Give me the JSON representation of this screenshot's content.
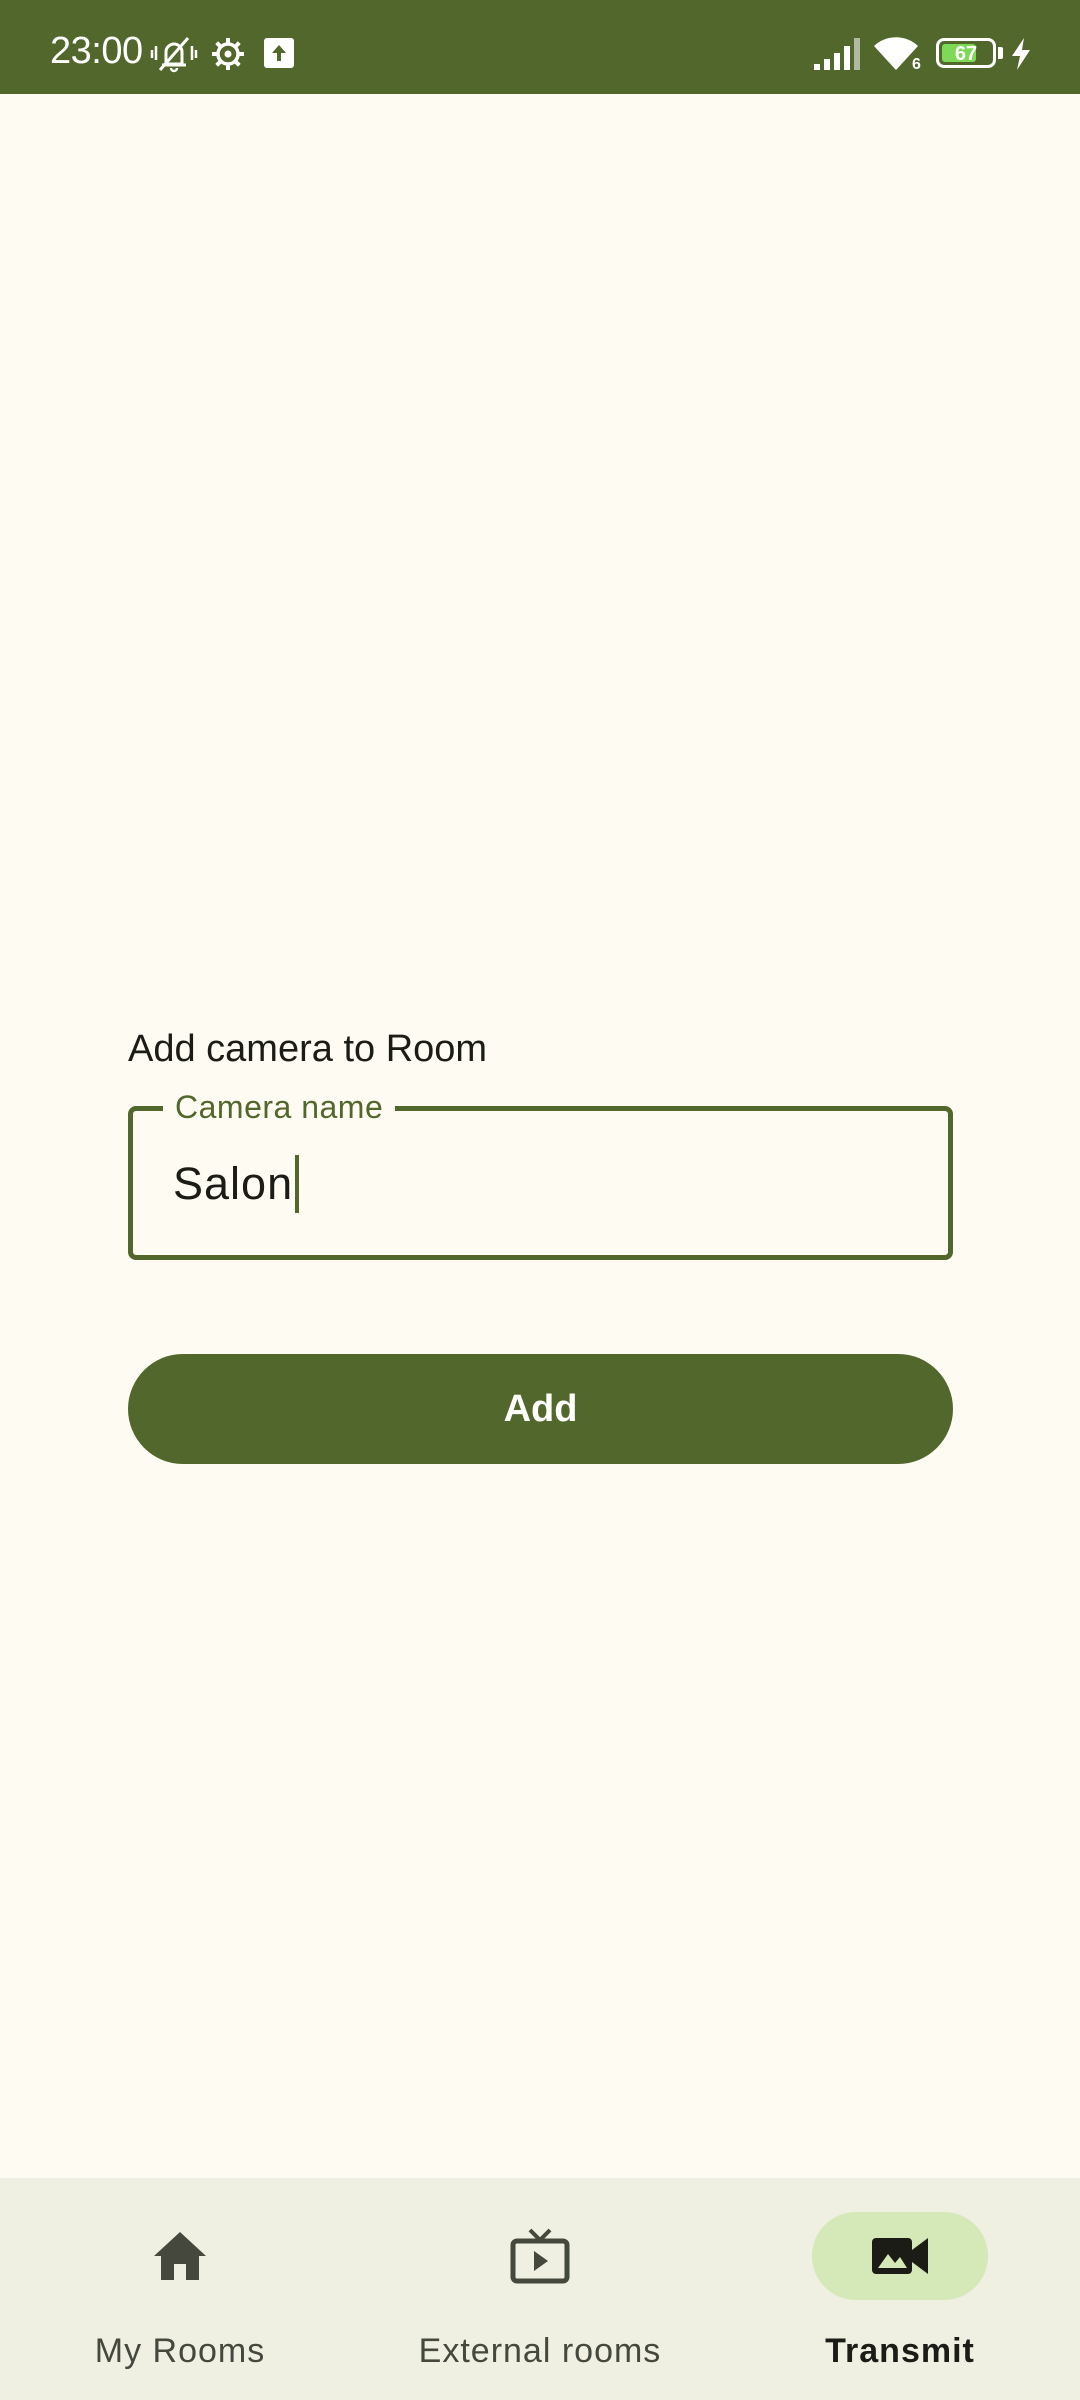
{
  "status_bar": {
    "time": "23:00",
    "battery_level": "67",
    "icons": [
      "vibrate-off-icon",
      "settings-gear-icon",
      "upload-icon",
      "signal-icon",
      "wifi-icon",
      "battery-icon",
      "charging-bolt-icon"
    ],
    "wifi_label": "6"
  },
  "form": {
    "title": "Add camera to Room",
    "camera_name": {
      "label": "Camera name",
      "value": "Salon"
    },
    "add_button_label": "Add"
  },
  "bottom_nav": {
    "items": [
      {
        "label": "My Rooms",
        "icon": "home-icon",
        "active": false
      },
      {
        "label": "External rooms",
        "icon": "live-tv-icon",
        "active": false
      },
      {
        "label": "Transmit",
        "icon": "videocam-icon",
        "active": true
      }
    ]
  },
  "colors": {
    "primary": "#52672B",
    "background": "#FEFBF3",
    "nav_background": "#EFEFE2",
    "active_indicator": "#D5E8B8"
  }
}
